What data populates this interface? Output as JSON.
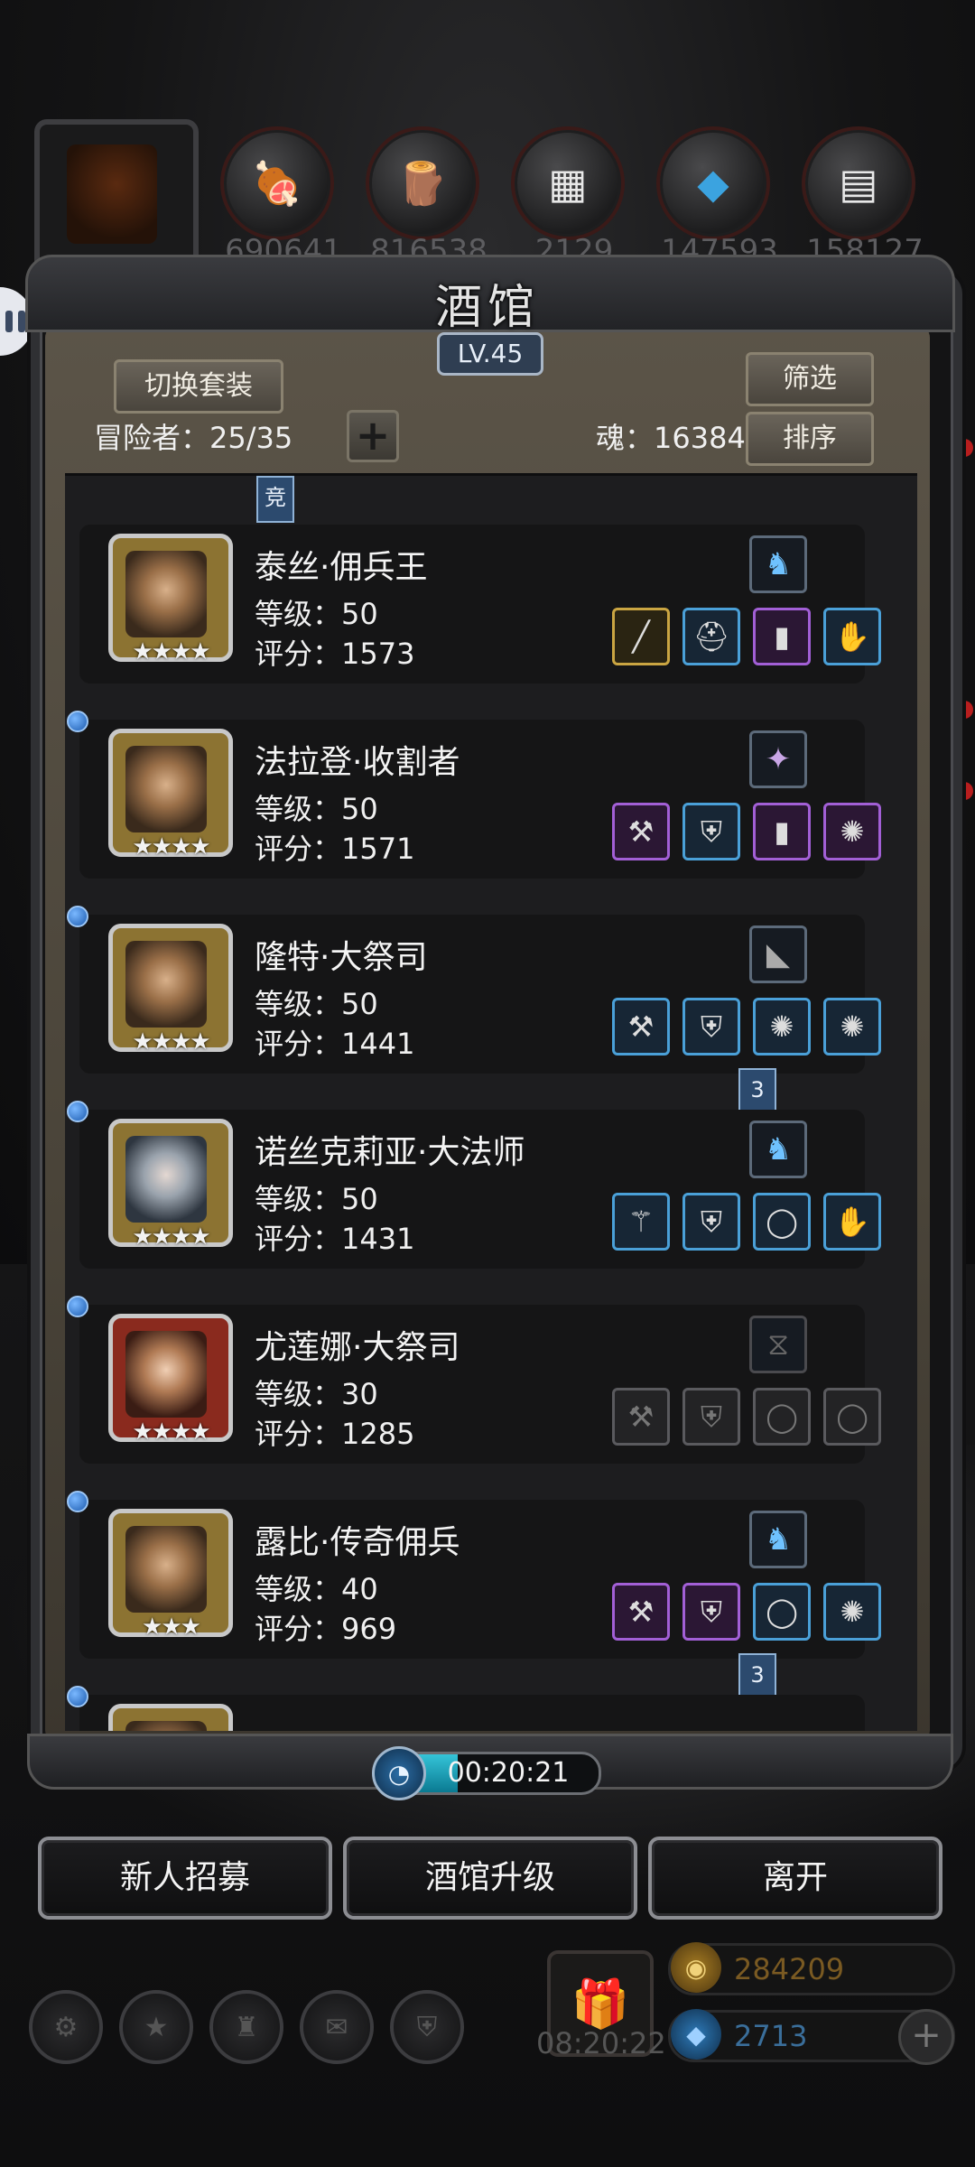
{
  "resources": [
    {
      "icon": "meat-icon",
      "value": "690641"
    },
    {
      "icon": "wood-icon",
      "value": "816538"
    },
    {
      "icon": "iron-icon",
      "value": "2129"
    },
    {
      "icon": "crystal-icon",
      "value": "147593"
    },
    {
      "icon": "steel-icon",
      "value": "158127"
    }
  ],
  "panel": {
    "title": "酒馆",
    "level": "LV.45",
    "switch_set_label": "切换套装",
    "filter_label": "筛选",
    "sort_label": "排序",
    "adventurers_label": "冒险者：25/35",
    "soul_label": "魂：16384",
    "tag_compete": "竞",
    "tag_three": "3"
  },
  "heroes": [
    {
      "name": "泰丝·佣兵王",
      "level": "等级：50",
      "score": "评分：1573",
      "stars": "★★★★",
      "frame": "gold",
      "gem": "blue-gem-icon",
      "equip": [
        {
          "icon": "crossbow-icon",
          "rarity": "gold"
        },
        {
          "icon": "helmet-icon",
          "rarity": "blue"
        },
        {
          "icon": "scroll-icon",
          "rarity": "purple"
        },
        {
          "icon": "gauntlet-icon",
          "rarity": "blue"
        }
      ]
    },
    {
      "name": "法拉登·收割者",
      "level": "等级：50",
      "score": "评分：1571",
      "stars": "★★★★",
      "frame": "gold",
      "gem": "purple-gem-icon",
      "equip": [
        {
          "icon": "axe-icon",
          "rarity": "purple"
        },
        {
          "icon": "armor-icon",
          "rarity": "blue"
        },
        {
          "icon": "scroll-icon",
          "rarity": "purple"
        },
        {
          "icon": "amulet-icon",
          "rarity": "purple"
        }
      ]
    },
    {
      "name": "隆特·大祭司",
      "level": "等级：50",
      "score": "评分：1441",
      "stars": "★★★★",
      "frame": "gold",
      "gem": "dark-gem-icon",
      "equip": [
        {
          "icon": "hammer-icon",
          "rarity": "blue"
        },
        {
          "icon": "armor-icon",
          "rarity": "blue"
        },
        {
          "icon": "amulet-icon",
          "rarity": "blue"
        },
        {
          "icon": "amulet-icon",
          "rarity": "blue"
        }
      ]
    },
    {
      "name": "诺丝克莉亚·大法师",
      "level": "等级：50",
      "score": "评分：1431",
      "stars": "★★★★",
      "frame": "gold",
      "gem": "blue-gem-icon",
      "equip": [
        {
          "icon": "staff-icon",
          "rarity": "blue"
        },
        {
          "icon": "armor-icon",
          "rarity": "blue"
        },
        {
          "icon": "ring-icon",
          "rarity": "blue"
        },
        {
          "icon": "gauntlet-icon",
          "rarity": "blue"
        }
      ]
    },
    {
      "name": "尤莲娜·大祭司",
      "level": "等级：30",
      "score": "评分：1285",
      "stars": "★★★★",
      "frame": "red",
      "gem": "empty-gem-icon",
      "equip": [
        {
          "icon": "hammer-icon",
          "rarity": "gray"
        },
        {
          "icon": "armor-icon",
          "rarity": "gray"
        },
        {
          "icon": "ring-icon",
          "rarity": "gray"
        },
        {
          "icon": "ring-icon",
          "rarity": "gray"
        }
      ]
    },
    {
      "name": "露比·传奇佣兵",
      "level": "等级：40",
      "score": "评分：969",
      "stars": "★★★",
      "frame": "gold",
      "gem": "blue-gem-icon",
      "equip": [
        {
          "icon": "axe-icon",
          "rarity": "purple"
        },
        {
          "icon": "armor-icon",
          "rarity": "purple"
        },
        {
          "icon": "ring-icon",
          "rarity": "blue"
        },
        {
          "icon": "amulet-icon",
          "rarity": "blue"
        }
      ]
    }
  ],
  "timer": {
    "text": "00:20:21",
    "progress": 0.35
  },
  "actions": {
    "recruit": "新人招募",
    "upgrade": "酒馆升级",
    "leave": "离开"
  },
  "hud": {
    "gift_time": "08:20:22",
    "gold": "284209",
    "diamonds": "2713",
    "icons": [
      "gear-icon",
      "star-icon",
      "tower-icon",
      "mail-icon",
      "shield-icon"
    ]
  },
  "colors": {
    "gold_frame": "#caa542",
    "blue_frame": "#4aa0d8",
    "purple_frame": "#a25fd6",
    "timer_fill": "#35c4d8"
  }
}
